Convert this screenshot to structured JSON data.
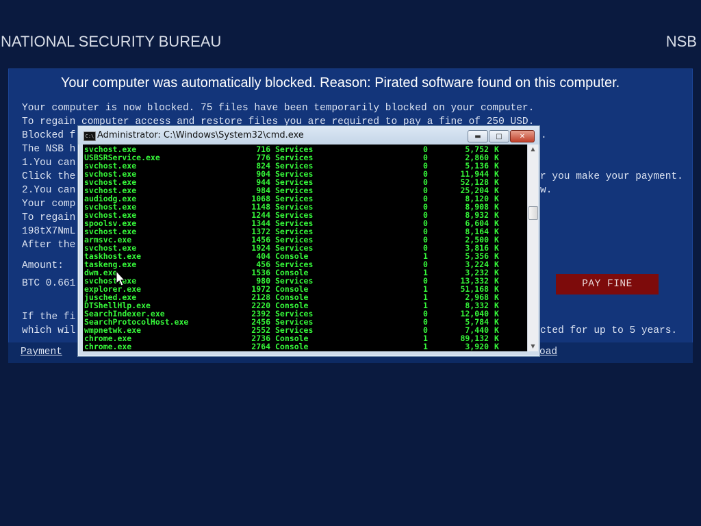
{
  "header": {
    "org_name": "NATIONAL SECURITY BUREAU",
    "org_abbr": "NSB"
  },
  "notice": {
    "headline": "Your computer was automatically blocked. Reason: Pirated software found on this computer.",
    "line1": "Your computer is now blocked. 75 files have been temporarily blocked on your computer.",
    "line2": "To regain computer access and restore files you are required to pay a fine of 250 USD.",
    "line3": "Blocked f",
    "line3_right": ".",
    "line4": "The NSB h",
    "line5": "1.You can",
    "line6": "Click the",
    "line6_right": "r you make your payment.",
    "line7": "2.You can",
    "line7_right": "w.",
    "line8": "Your comp",
    "line9": "To regain",
    "line10": "198tX7NmL",
    "line11": "After the",
    "amount_label": "Amount:",
    "btc_amount": "BTC 0.661",
    "pay_fine_label": "PAY FINE",
    "bottom_line1": "If the fi",
    "bottom_line2": "which wil",
    "bottom_line2_right": "cted for up to 5 years.",
    "payment_link": "Payment",
    "right_link": "oad"
  },
  "cmd_window": {
    "title": "Administrator: C:\\Windows\\System32\\cmd.exe",
    "icon": "cmd-icon",
    "minimize": "minimize-icon",
    "maximize": "maximize-icon",
    "close": "close-icon",
    "text_color": "#36f83a",
    "processes": [
      {
        "name": "svchost.exe",
        "pid": "716",
        "session": "Services",
        "num": "0",
        "mem": "5,752",
        "unit": "K"
      },
      {
        "name": "USBSRService.exe",
        "pid": "776",
        "session": "Services",
        "num": "0",
        "mem": "2,860",
        "unit": "K"
      },
      {
        "name": "svchost.exe",
        "pid": "824",
        "session": "Services",
        "num": "0",
        "mem": "5,136",
        "unit": "K"
      },
      {
        "name": "svchost.exe",
        "pid": "904",
        "session": "Services",
        "num": "0",
        "mem": "11,944",
        "unit": "K"
      },
      {
        "name": "svchost.exe",
        "pid": "944",
        "session": "Services",
        "num": "0",
        "mem": "52,128",
        "unit": "K"
      },
      {
        "name": "svchost.exe",
        "pid": "984",
        "session": "Services",
        "num": "0",
        "mem": "25,204",
        "unit": "K"
      },
      {
        "name": "audiodg.exe",
        "pid": "1068",
        "session": "Services",
        "num": "0",
        "mem": "8,120",
        "unit": "K"
      },
      {
        "name": "svchost.exe",
        "pid": "1148",
        "session": "Services",
        "num": "0",
        "mem": "8,908",
        "unit": "K"
      },
      {
        "name": "svchost.exe",
        "pid": "1244",
        "session": "Services",
        "num": "0",
        "mem": "8,932",
        "unit": "K"
      },
      {
        "name": "spoolsv.exe",
        "pid": "1344",
        "session": "Services",
        "num": "0",
        "mem": "6,604",
        "unit": "K"
      },
      {
        "name": "svchost.exe",
        "pid": "1372",
        "session": "Services",
        "num": "0",
        "mem": "8,164",
        "unit": "K"
      },
      {
        "name": "armsvc.exe",
        "pid": "1456",
        "session": "Services",
        "num": "0",
        "mem": "2,500",
        "unit": "K"
      },
      {
        "name": "svchost.exe",
        "pid": "1924",
        "session": "Services",
        "num": "0",
        "mem": "3,816",
        "unit": "K"
      },
      {
        "name": "taskhost.exe",
        "pid": "404",
        "session": "Console",
        "num": "1",
        "mem": "5,356",
        "unit": "K"
      },
      {
        "name": "taskeng.exe",
        "pid": "456",
        "session": "Services",
        "num": "0",
        "mem": "3,224",
        "unit": "K"
      },
      {
        "name": "dwm.exe",
        "pid": "1536",
        "session": "Console",
        "num": "1",
        "mem": "3,232",
        "unit": "K"
      },
      {
        "name": "svchost.exe",
        "pid": "980",
        "session": "Services",
        "num": "0",
        "mem": "13,332",
        "unit": "K"
      },
      {
        "name": "explorer.exe",
        "pid": "1972",
        "session": "Console",
        "num": "1",
        "mem": "51,168",
        "unit": "K"
      },
      {
        "name": "jusched.exe",
        "pid": "2128",
        "session": "Console",
        "num": "1",
        "mem": "2,968",
        "unit": "K"
      },
      {
        "name": "DTShellHlp.exe",
        "pid": "2220",
        "session": "Console",
        "num": "1",
        "mem": "8,332",
        "unit": "K"
      },
      {
        "name": "SearchIndexer.exe",
        "pid": "2392",
        "session": "Services",
        "num": "0",
        "mem": "12,040",
        "unit": "K"
      },
      {
        "name": "SearchProtocolHost.exe",
        "pid": "2456",
        "session": "Services",
        "num": "0",
        "mem": "5,784",
        "unit": "K"
      },
      {
        "name": "wmpnetwk.exe",
        "pid": "2552",
        "session": "Services",
        "num": "0",
        "mem": "7,440",
        "unit": "K"
      },
      {
        "name": "chrome.exe",
        "pid": "2736",
        "session": "Console",
        "num": "1",
        "mem": "89,132",
        "unit": "K"
      },
      {
        "name": "chrome.exe",
        "pid": "2764",
        "session": "Console",
        "num": "1",
        "mem": "3,920",
        "unit": "K"
      }
    ]
  },
  "colors": {
    "background": "#0a1a3f",
    "panel": "#13357a",
    "pay_button": "#7d0b0b",
    "terminal_text": "#36f83a"
  }
}
